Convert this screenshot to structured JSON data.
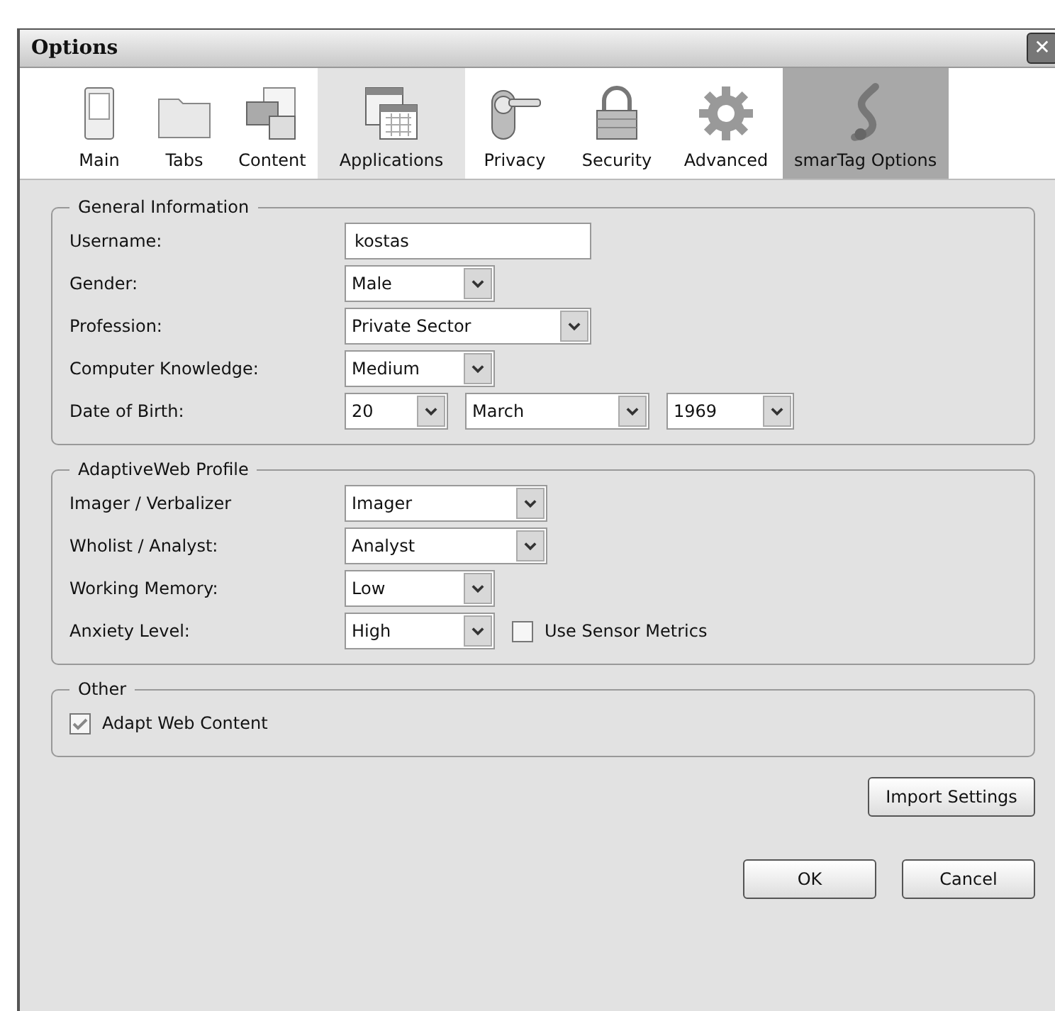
{
  "window": {
    "title": "Options",
    "close": "✕"
  },
  "tabs": [
    {
      "label": "Main",
      "selected": false,
      "hovered": false
    },
    {
      "label": "Tabs",
      "selected": false,
      "hovered": false
    },
    {
      "label": "Content",
      "selected": false,
      "hovered": false
    },
    {
      "label": "Applications",
      "selected": false,
      "hovered": true
    },
    {
      "label": "Privacy",
      "selected": false,
      "hovered": false
    },
    {
      "label": "Security",
      "selected": false,
      "hovered": false
    },
    {
      "label": "Advanced",
      "selected": false,
      "hovered": false
    },
    {
      "label": "smarTag Options",
      "selected": true,
      "hovered": false
    }
  ],
  "groups": [
    {
      "title": "General Information",
      "rows": [
        {
          "label": "Username:",
          "fields": [
            {
              "kind": "text",
              "value": "kostas"
            }
          ]
        },
        {
          "label": "Gender:",
          "fields": [
            {
              "kind": "select",
              "value": "Male"
            }
          ]
        },
        {
          "label": "Profession:",
          "fields": [
            {
              "kind": "select",
              "value": "Private Sector"
            }
          ]
        },
        {
          "label": "Computer Knowledge:",
          "fields": [
            {
              "kind": "select",
              "value": "Medium"
            }
          ]
        },
        {
          "label": "Date of Birth:",
          "fields": [
            {
              "kind": "select",
              "value": "20"
            },
            {
              "kind": "select",
              "value": "March"
            },
            {
              "kind": "select",
              "value": "1969"
            }
          ]
        }
      ]
    },
    {
      "title": "AdaptiveWeb Profile",
      "rows": [
        {
          "label": "Imager / Verbalizer",
          "fields": [
            {
              "kind": "select",
              "value": "Imager"
            }
          ]
        },
        {
          "label": "Wholist / Analyst:",
          "fields": [
            {
              "kind": "select",
              "value": "Analyst"
            }
          ]
        },
        {
          "label": "Working Memory:",
          "fields": [
            {
              "kind": "select",
              "value": "Low"
            }
          ]
        },
        {
          "label": "Anxiety Level:",
          "fields": [
            {
              "kind": "select",
              "value": "High"
            },
            {
              "kind": "checkbox",
              "label": "Use Sensor Metrics",
              "checked": false
            }
          ]
        }
      ]
    },
    {
      "title": "Other",
      "rows": [
        {
          "fields": [
            {
              "kind": "checkbox",
              "label": "Adapt Web Content",
              "checked": true
            }
          ]
        }
      ]
    }
  ],
  "buttons": {
    "import": "Import Settings",
    "ok": "OK",
    "cancel": "Cancel"
  }
}
